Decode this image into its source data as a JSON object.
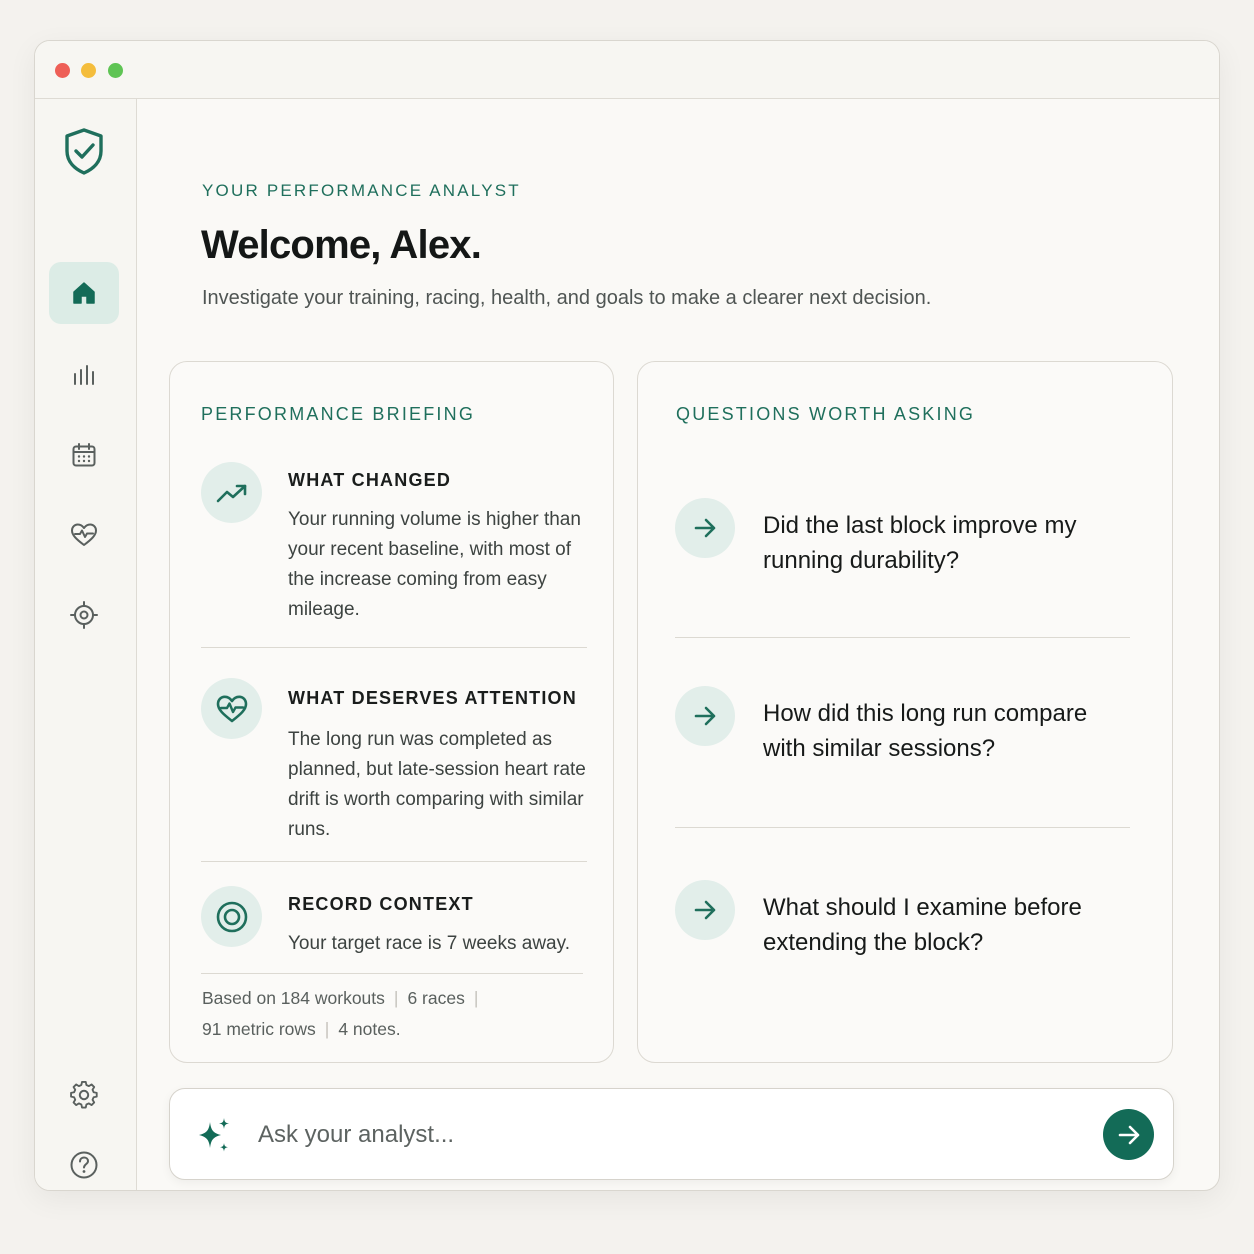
{
  "window": {
    "controls": [
      "close",
      "minimize",
      "maximize"
    ]
  },
  "sidebar": {
    "logo_icon": "shield-check-icon",
    "items": [
      {
        "icon": "home-icon",
        "active": true
      },
      {
        "icon": "bar-chart-icon",
        "active": false
      },
      {
        "icon": "calendar-icon",
        "active": false
      },
      {
        "icon": "heart-pulse-icon",
        "active": false
      },
      {
        "icon": "target-icon",
        "active": false
      }
    ],
    "bottom_items": [
      {
        "icon": "gear-icon"
      },
      {
        "icon": "help-icon"
      }
    ]
  },
  "header": {
    "eyebrow": "YOUR PERFORMANCE ANALYST",
    "title": "Welcome, Alex.",
    "subtitle": "Investigate your training, racing, health, and goals to make a clearer next decision."
  },
  "briefing": {
    "title": "PERFORMANCE BRIEFING",
    "items": [
      {
        "icon": "trend-up-icon",
        "heading": "WHAT CHANGED",
        "text": "Your running volume is higher than your recent baseline, with most of the increase coming from easy mileage."
      },
      {
        "icon": "heart-pulse-icon",
        "heading": "WHAT DESERVES ATTENTION",
        "text": "The long run was completed as planned, but late-session heart rate drift is worth comparing with similar runs."
      },
      {
        "icon": "target-icon",
        "heading": "RECORD CONTEXT",
        "text": "Your target race is 7 weeks away."
      }
    ],
    "footer": {
      "workouts": "Based on 184 workouts",
      "races": "6 races",
      "metric_rows": "91 metric rows",
      "notes": "4 notes."
    }
  },
  "questions": {
    "title": "QUESTIONS WORTH ASKING",
    "items": [
      {
        "icon": "arrow-right-icon",
        "text": "Did the last block improve my running durability?"
      },
      {
        "icon": "arrow-right-icon",
        "text": "How did this long run compare with similar sessions?"
      },
      {
        "icon": "arrow-right-icon",
        "text": "What should I examine before extending the block?"
      }
    ]
  },
  "ask": {
    "icon": "sparkle-icon",
    "placeholder": "Ask your analyst...",
    "value": "",
    "send_icon": "arrow-right-icon"
  },
  "colors": {
    "accent": "#136b57",
    "accent_text": "#1f6f5c",
    "accent_soft": "#e2eeea",
    "background": "#faf9f6"
  }
}
